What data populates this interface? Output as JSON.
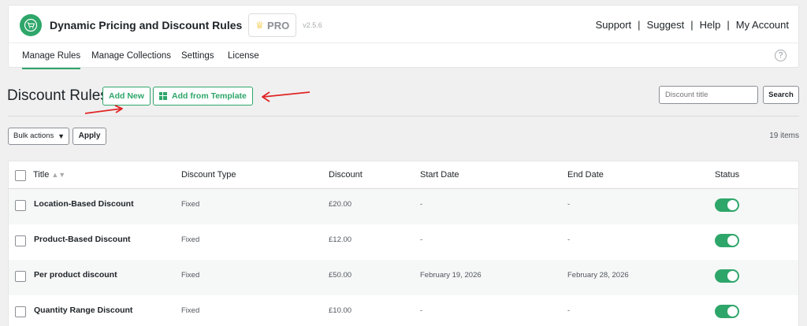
{
  "app": {
    "title": "Dynamic Pricing and Discount Rules",
    "pro_label": "PRO",
    "version": "v2.5.6",
    "brand_color": "#2ea66a"
  },
  "top_links": [
    "Support",
    "Suggest",
    "Help",
    "My Account"
  ],
  "tabs": [
    {
      "label": "Manage Rules",
      "active": true
    },
    {
      "label": "Manage Collections",
      "active": false
    },
    {
      "label": "Settings",
      "active": false
    },
    {
      "label": "License",
      "active": false
    }
  ],
  "page": {
    "heading": "Discount Rules",
    "add_new_label": "Add New",
    "add_template_label": "Add from Template",
    "search_placeholder": "Discount title",
    "search_label": "Search",
    "bulk_label": "Bulk actions",
    "apply_label": "Apply",
    "items_count": "19 items"
  },
  "table": {
    "columns": [
      "Title",
      "Discount Type",
      "Discount",
      "Start Date",
      "End Date",
      "Status"
    ],
    "rows": [
      {
        "title": "Location-Based Discount",
        "type": "Fixed",
        "discount": "£20.00",
        "start": "-",
        "end": "-",
        "status_on": true
      },
      {
        "title": "Product-Based Discount",
        "type": "Fixed",
        "discount": "£12.00",
        "start": "-",
        "end": "-",
        "status_on": true
      },
      {
        "title": "Per product discount",
        "type": "Fixed",
        "discount": "£50.00",
        "start": "February 19, 2026",
        "end": "February 28, 2026",
        "status_on": true
      },
      {
        "title": "Quantity Range Discount",
        "type": "Fixed",
        "discount": "£10.00",
        "start": "-",
        "end": "-",
        "status_on": true
      }
    ]
  },
  "annotation_color": "#e02424"
}
